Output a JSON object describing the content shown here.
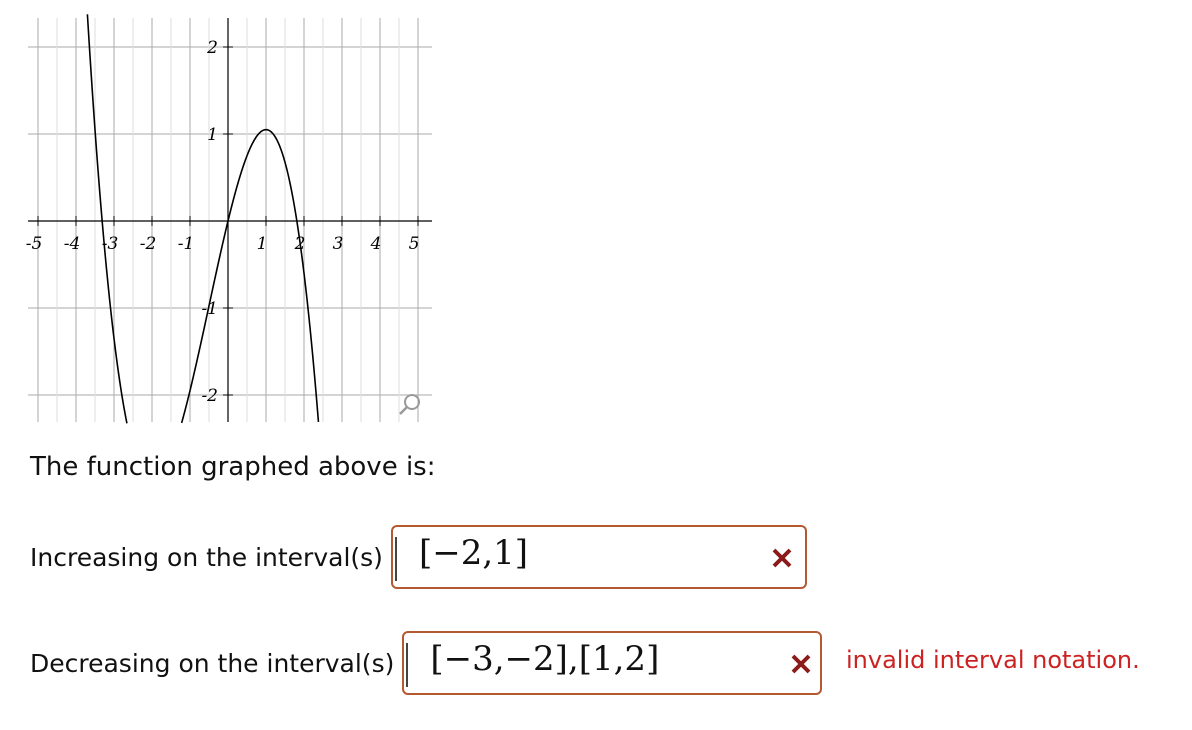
{
  "graph": {
    "x_tick_labels": [
      "-5",
      "-4",
      "-3",
      "-2",
      "-1",
      "1",
      "2",
      "3",
      "4",
      "5"
    ],
    "y_tick_labels": [
      "2",
      "1",
      "-1",
      "-2"
    ],
    "x_range": [
      -5,
      5
    ],
    "y_range": [
      -2.5,
      2.5
    ],
    "curve_description_points": [
      [
        -3.15,
        2.5
      ],
      [
        -2,
        -1.5
      ],
      [
        1,
        1.05
      ],
      [
        2.3,
        -2.5
      ]
    ],
    "zoom_icon": "magnifier-icon"
  },
  "question": {
    "prompt": "The function graphed above is:"
  },
  "increasing": {
    "label": "Increasing on the interval(s)",
    "value": "[−2,1]",
    "status_icon": "x-icon",
    "status_color": "#8b1a1a"
  },
  "decreasing": {
    "label": "Decreasing on the interval(s)",
    "value": "[−3,−2],[1,2]",
    "status_icon": "x-icon",
    "status_color": "#8b1a1a",
    "feedback": "invalid interval notation."
  },
  "colors": {
    "box_border": "#b35a30",
    "feedback_text": "#cc2222"
  }
}
